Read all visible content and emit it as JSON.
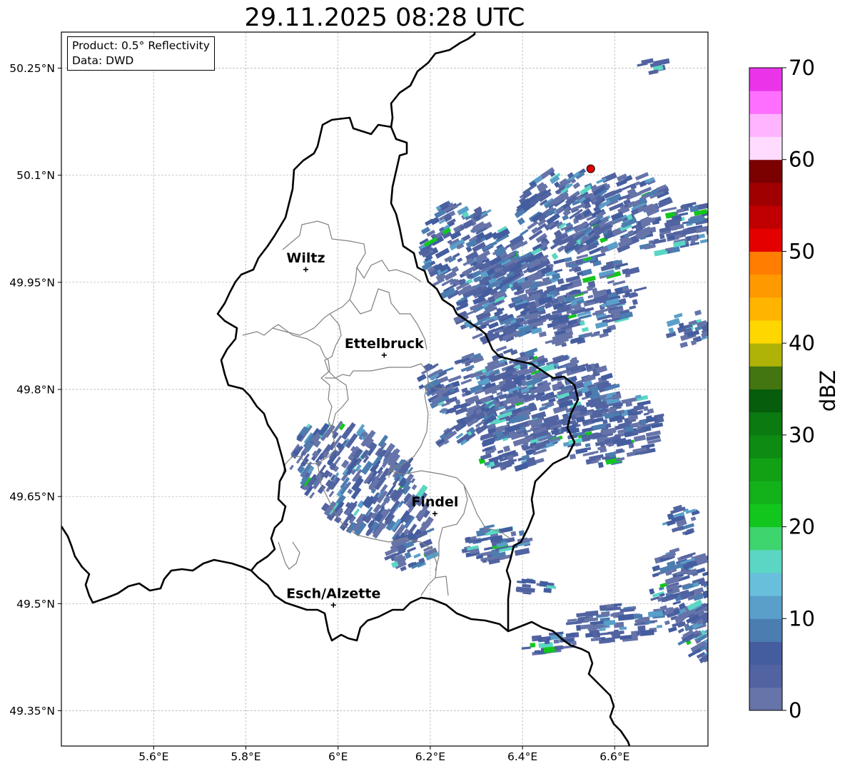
{
  "title": "29.11.2025 08:28 UTC",
  "info": {
    "product": "Product: 0.5° Reflectivity",
    "data": "Data: DWD"
  },
  "map": {
    "lon_range": [
      5.4,
      6.8
    ],
    "lat_range": [
      49.3,
      50.3
    ],
    "lon_ticks": [
      {
        "value": 5.6,
        "label": "5.6°E"
      },
      {
        "value": 5.8,
        "label": "5.8°E"
      },
      {
        "value": 6.0,
        "label": "6°E"
      },
      {
        "value": 6.2,
        "label": "6.2°E"
      },
      {
        "value": 6.4,
        "label": "6.4°E"
      },
      {
        "value": 6.6,
        "label": "6.6°E"
      }
    ],
    "lat_ticks": [
      {
        "value": 50.25,
        "label": "50.25°N"
      },
      {
        "value": 50.1,
        "label": "50.1°N"
      },
      {
        "value": 49.95,
        "label": "49.95°N"
      },
      {
        "value": 49.8,
        "label": "49.8°N"
      },
      {
        "value": 49.65,
        "label": "49.65°N"
      },
      {
        "value": 49.5,
        "label": "49.5°N"
      },
      {
        "value": 49.35,
        "label": "49.35°N"
      }
    ],
    "grid": true,
    "cities": [
      {
        "name": "Wiltz",
        "lon": 5.93,
        "lat": 49.968
      },
      {
        "name": "Ettelbruck",
        "lon": 6.1,
        "lat": 49.848
      },
      {
        "name": "Findel",
        "lon": 6.21,
        "lat": 49.626
      },
      {
        "name": "Esch/Alzette",
        "lon": 5.99,
        "lat": 49.498
      }
    ],
    "radar_site": {
      "lon": 6.548,
      "lat": 50.109,
      "color": "#e00000"
    },
    "colors": {
      "border": "#000000",
      "canton": "#808080",
      "grid": "#b0b0b0"
    }
  },
  "colorbar": {
    "label": "dBZ",
    "min": 0,
    "max": 70,
    "step": 2.5,
    "ticks": [
      0,
      10,
      20,
      30,
      40,
      50,
      60,
      70
    ],
    "colors": [
      "#6674a9",
      "#5163a0",
      "#445d9f",
      "#4b7db0",
      "#5a9fc9",
      "#67bfdc",
      "#5bd6c4",
      "#3ed46e",
      "#13c61d",
      "#13b11a",
      "#12a015",
      "#0d8b12",
      "#0b7a10",
      "#065d0c",
      "#437510",
      "#b0b307",
      "#ffd700",
      "#ffb500",
      "#ff9900",
      "#ff7d00",
      "#e50000",
      "#c00000",
      "#a00000",
      "#7b0000",
      "#ffdcff",
      "#ffb4ff",
      "#ff6fff",
      "#ea34ea"
    ]
  }
}
